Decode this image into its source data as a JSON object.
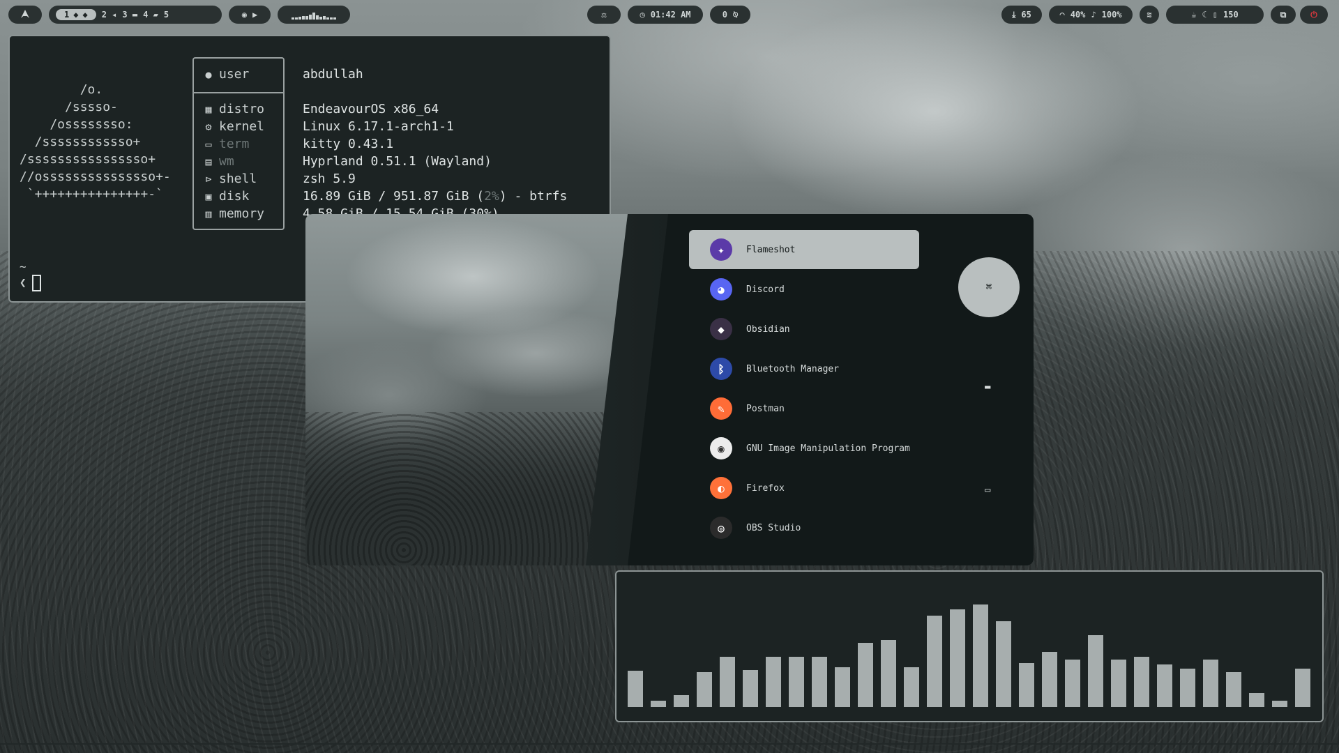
{
  "topbar": {
    "launcher_icon": "arch-logo-icon",
    "workspaces": {
      "active": "1",
      "others": [
        "2",
        "3",
        "4",
        "5"
      ]
    },
    "media_icons": [
      "record-icon",
      "play-icon"
    ],
    "center_icon": "balance-scale-icon",
    "clock": "01:42 AM",
    "notifications": "0",
    "updates": "65",
    "headphone_volume": "40%",
    "mic_volume": "100%",
    "battery": "150"
  },
  "terminal": {
    "ascii_logo": "        /o.\n      /sssso-\n    /ossssssso:\n  /ssssssssssso+\n/ssssssssssssssso+\n//osssssssssssssso+-\n `+++++++++++++++-`",
    "keys": [
      "user",
      "distro",
      "kernel",
      "term",
      "wm",
      "shell",
      "disk",
      "memory"
    ],
    "values": {
      "user": "abdullah",
      "distro": "EndeavourOS x86_64",
      "kernel": "Linux 6.17.1-arch1-1",
      "term": "kitty 0.43.1",
      "wm": "Hyprland 0.51.1 (Wayland)",
      "shell": "zsh 5.9",
      "disk_a": "16.89 GiB / 951.87 GiB (",
      "disk_pct": "2%",
      "disk_b": ") - btrfs",
      "memory": "4.58 GiB / 15.54 GiB (30%)"
    },
    "prompt_dir": "~",
    "prompt_symbol": "❮"
  },
  "launcher": {
    "apps": [
      {
        "name": "Flameshot",
        "icon": "flameshot-icon",
        "color": "#5b3aa8",
        "selected": true
      },
      {
        "name": "Discord",
        "icon": "discord-icon",
        "color": "#5865f2",
        "selected": false
      },
      {
        "name": "Obsidian",
        "icon": "obsidian-icon",
        "color": "#3a3046",
        "selected": false
      },
      {
        "name": "Bluetooth Manager",
        "icon": "bluetooth-icon",
        "color": "#2d4aa8",
        "selected": false
      },
      {
        "name": "Postman",
        "icon": "postman-icon",
        "color": "#ff6c37",
        "selected": false
      },
      {
        "name": "GNU Image Manipulation Program",
        "icon": "gimp-icon",
        "color": "#ececec",
        "selected": false
      },
      {
        "name": "Firefox",
        "icon": "firefox-icon",
        "color": "#ff7139",
        "selected": false
      },
      {
        "name": "OBS Studio",
        "icon": "obs-icon",
        "color": "#2b2b2b",
        "selected": false
      }
    ],
    "mode_icons": [
      "apps-grid-icon",
      "folder-icon",
      "window-icon"
    ]
  },
  "visualizer": {
    "levels": [
      0.28,
      0.05,
      0.09,
      0.27,
      0.39,
      0.29,
      0.39,
      0.39,
      0.39,
      0.31,
      0.5,
      0.52,
      0.31,
      0.71,
      0.76,
      0.8,
      0.67,
      0.34,
      0.43,
      0.37,
      0.56,
      0.37,
      0.39,
      0.33,
      0.3,
      0.37,
      0.27,
      0.11,
      0.05,
      0.3
    ]
  }
}
